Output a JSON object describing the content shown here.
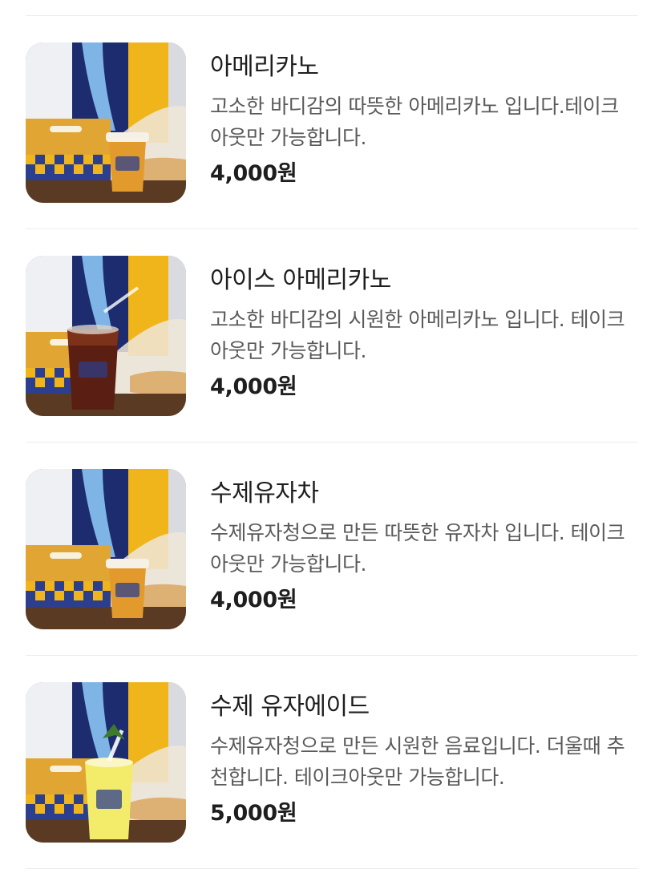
{
  "menu": {
    "items": [
      {
        "name": "아메리카노",
        "description": "고소한 바디감의 따뜻한 아메리카노 입니다.테이크아웃만 가능합니다.",
        "price": "4,000원",
        "drink": "hot-coffee"
      },
      {
        "name": "아이스 아메리카노",
        "description": "고소한 바디감의 시원한 아메리카노 입니다. 테이크아웃만 가능합니다.",
        "price": "4,000원",
        "drink": "iced-coffee"
      },
      {
        "name": "수제유자차",
        "description": "수제유자청으로 만든 따뜻한 유자차 입니다. 테이크아웃만 가능합니다.",
        "price": "4,000원",
        "drink": "hot-tea"
      },
      {
        "name": "수제 유자에이드",
        "description": "수제유자청으로 만든 시원한 음료입니다. 더울때 추천합니다. 테이크아웃만 가능합니다.",
        "price": "5,000원",
        "drink": "yuja-ade"
      }
    ]
  },
  "colors": {
    "divider": "#ececec",
    "title": "#1e1e1e",
    "description": "#5a5a5a",
    "brand_yellow": "#f1b51c",
    "brand_blue": "#2c3f8f"
  }
}
